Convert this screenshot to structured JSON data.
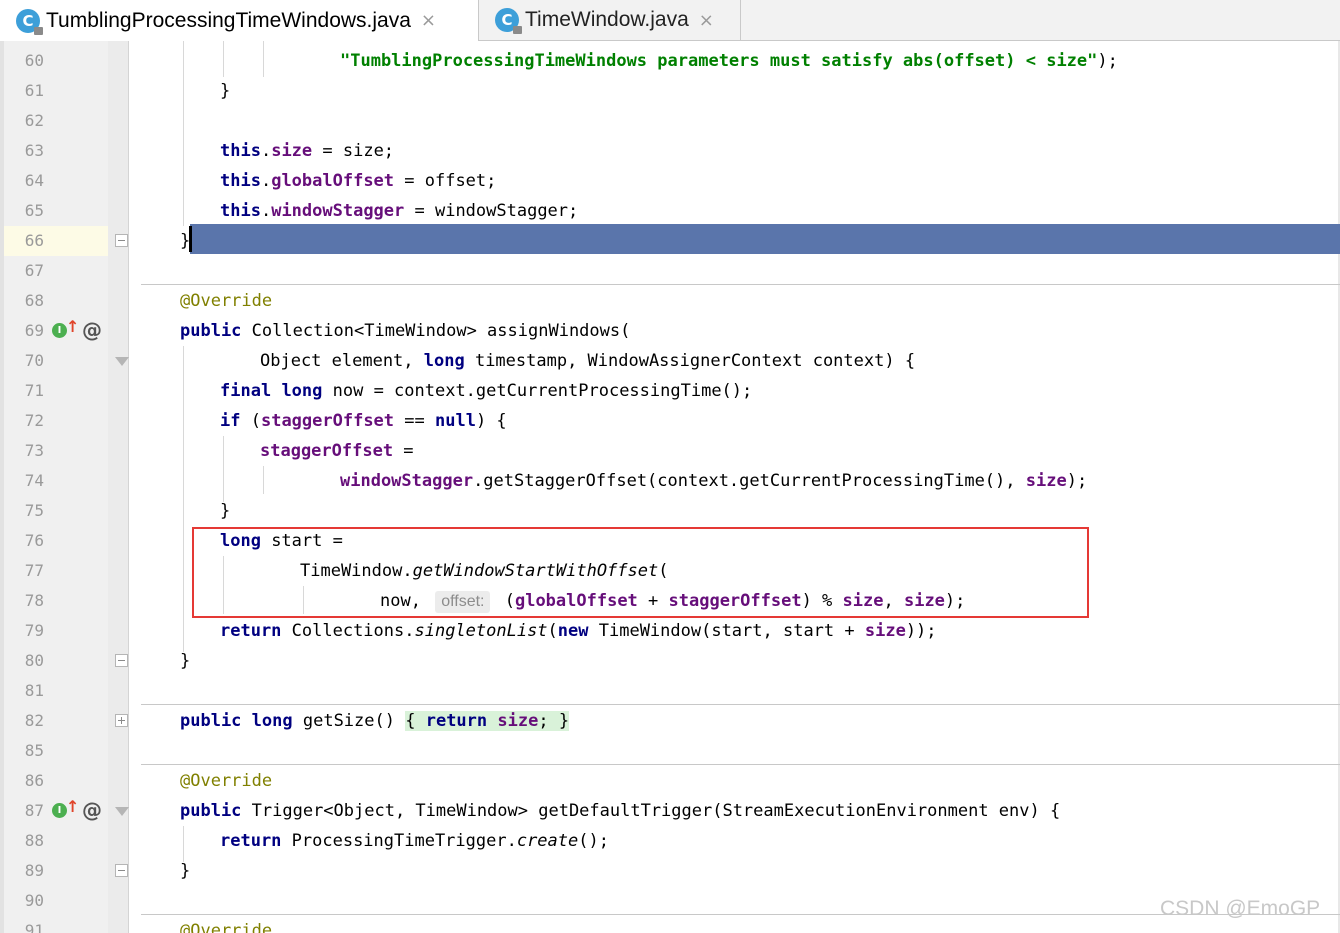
{
  "tabs": [
    {
      "label": "TumblingProcessingTimeWindows.java",
      "icon_letter": "C",
      "active": true
    },
    {
      "label": "TimeWindow.java",
      "icon_letter": "C",
      "active": false
    }
  ],
  "close_glyph": "×",
  "line_numbers": [
    "60",
    "61",
    "62",
    "63",
    "64",
    "65",
    "66",
    "67",
    "68",
    "69",
    "70",
    "71",
    "72",
    "73",
    "74",
    "75",
    "76",
    "77",
    "78",
    "79",
    "80",
    "81",
    "82",
    "85",
    "86",
    "87",
    "88",
    "89",
    "90",
    "91"
  ],
  "code": {
    "l60_str": "\"TumblingProcessingTimeWindows parameters must satisfy abs(offset) < size\"",
    "l60_end": ");",
    "l61": "}",
    "l63_this": "this",
    "l63_field": "size",
    "l63_rest": " = size;",
    "l64_this": "this",
    "l64_field": "globalOffset",
    "l64_rest": " = offset;",
    "l65_this": "this",
    "l65_field": "windowStagger",
    "l65_rest": " = windowStagger;",
    "l66": "}",
    "l68_ann": "@Override",
    "l69_kw": "public",
    "l69_rest": " Collection<TimeWindow> assignWindows(",
    "l70_a": "Object element, ",
    "l70_kw": "long",
    "l70_b": " timestamp, WindowAssignerContext context) {",
    "l71_kw1": "final",
    "l71_kw2": "long",
    "l71_rest": " now = context.getCurrentProcessingTime();",
    "l72_kw": "if",
    "l72_a": " (",
    "l72_field": "staggerOffset",
    "l72_b": " == ",
    "l72_null": "null",
    "l72_c": ") {",
    "l73_field": "staggerOffset",
    "l73_rest": " =",
    "l74_field": "windowStagger",
    "l74_a": ".getStaggerOffset(context.getCurrentProcessingTime(), ",
    "l74_field2": "size",
    "l74_b": ");",
    "l75": "}",
    "l76_kw": "long",
    "l76_rest": " start =",
    "l77_a": "TimeWindow.",
    "l77_method": "getWindowStartWithOffset",
    "l77_b": "(",
    "l78_a": "now, ",
    "l78_hint": "offset:",
    "l78_b": " (",
    "l78_f1": "globalOffset",
    "l78_c": " + ",
    "l78_f2": "staggerOffset",
    "l78_d": ") % ",
    "l78_f3": "size",
    "l78_e": ", ",
    "l78_f4": "size",
    "l78_g": ");",
    "l79_kw": "return",
    "l79_a": " Collections.",
    "l79_method": "singletonList",
    "l79_b": "(",
    "l79_new": "new",
    "l79_c": " TimeWindow(start, start + ",
    "l79_field": "size",
    "l79_d": "));",
    "l80": "}",
    "l82_kw1": "public",
    "l82_kw2": "long",
    "l82_a": " getSize() ",
    "l82_ob": "{",
    "l82_ret": "return",
    "l82_field": "size",
    "l82_semi": ";",
    "l82_cb": "}",
    "l86_ann": "@Override",
    "l87_kw": "public",
    "l87_rest": " Trigger<Object, TimeWindow> getDefaultTrigger(StreamExecutionEnvironment env) {",
    "l88_kw": "return",
    "l88_a": " ProcessingTimeTrigger.",
    "l88_method": "create",
    "l88_b": "();",
    "l89": "}",
    "l91_ann": "@Override"
  },
  "gutter_icons": {
    "implements_letter": "I",
    "implements_arrow": "↑",
    "annotation_glyph": "@"
  },
  "watermark": "CSDN @EmoGP",
  "colors": {
    "keyword": "#000080",
    "field": "#660e7a",
    "string": "#008000",
    "annotation": "#808000",
    "selection": "#5a75ab",
    "highlight_box": "#e53935"
  }
}
